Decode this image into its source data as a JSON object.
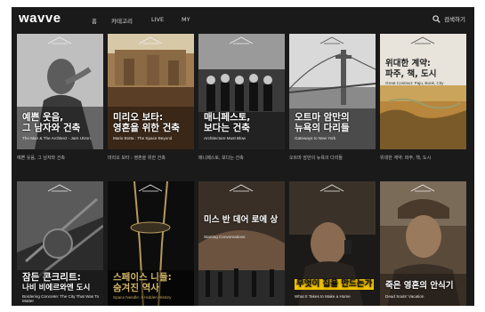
{
  "header": {
    "logo": "wavve",
    "nav": [
      "홈",
      "카테고리",
      "LIVE",
      "MY"
    ],
    "search_label": "검색하기"
  },
  "row1": [
    {
      "title_line1": "예쁜 웃음,",
      "title_line2": "그 남자와 건축",
      "subtitle": "The Man & The Architect - Jarn Utzon",
      "caption": "예쁜 웃음, 그 남자와 건축"
    },
    {
      "title_line1": "미리오 보타:",
      "title_line2": "영혼을 위한 건축",
      "subtitle": "Mario Botta : The Space Beyond",
      "caption": "마리오 보타 : 영혼을 위한 건축"
    },
    {
      "title_line1": "매니페스토,",
      "title_line2": "보다는 건축",
      "subtitle": "Architecture Must Blow",
      "caption": "매니페스토, 보다는 건축"
    },
    {
      "title_line1": "오트마 암만의",
      "title_line2": "뉴욕의 다리들",
      "subtitle": "Gateways to New York",
      "caption": "오트마 암만의 뉴욕의 다리들"
    },
    {
      "title_line1": "위대한 계약:",
      "title_line2": "파주, 책, 도시",
      "subtitle": "Great Contract: Paju, Book, City",
      "caption": "위대한 계약: 파주, 책, 도시"
    }
  ],
  "row2": [
    {
      "title_line1": "잠든 콘크리트:",
      "title_line2": "나비 비에르와엔 도시",
      "subtitle": "Bordering Concrete: The City That Was To Matter"
    },
    {
      "title_line1": "스페이스 니들:",
      "title_line2": "숨겨진 역사",
      "subtitle": "Space Needle: A Hidden History"
    },
    {
      "title_line1": "미스 반 데어 로에 상",
      "subtitle": "Starting Conversations"
    },
    {
      "title_line1": "무엇이 집을 만드는가",
      "subtitle": "What It Takes to Make a Home"
    },
    {
      "title_line1": "죽은 영혼의 안식기",
      "subtitle": "Dead Souls' Vacation"
    }
  ]
}
